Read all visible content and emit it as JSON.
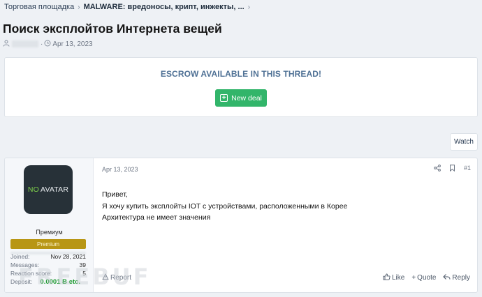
{
  "breadcrumb": {
    "items": [
      "Торговая площадка",
      "MALWARE: вредоносы, крипт, инжекты, ..."
    ],
    "separator": "›"
  },
  "thread": {
    "title": "Поиск эксплойтов Интернета вещей",
    "meta_separator": "·",
    "date": "Apr 13, 2023"
  },
  "escrow": {
    "title": "ESCROW AVAILABLE IN THIS THREAD!",
    "button_label": "New deal"
  },
  "watch_label": "Watch",
  "post": {
    "avatar": {
      "no": "NO",
      "avatar": "AVATAR"
    },
    "user_title": "Премиум",
    "user_banner": "Premium",
    "stats": [
      {
        "label": "Joined:",
        "value": "Nov 28, 2021"
      },
      {
        "label": "Messages:",
        "value": "39"
      },
      {
        "label": "Reaction score:",
        "value": "5"
      },
      {
        "label": "Deposit:",
        "value": "0.0001 Ƀ etc."
      }
    ],
    "date": "Apr 13, 2023",
    "number": "#1",
    "message_lines": [
      "Привет,",
      "Я хочу купить эксплойты IOT с устройствами, расположенными в Корее",
      "Архитектура не имеет значения"
    ],
    "report_label": "Report",
    "like_label": "Like",
    "quote_label": "Quote",
    "reply_label": "Reply"
  },
  "watermark": "FREEBUF",
  "colors": {
    "accent_blue": "#4f7195",
    "deal_green": "#32b56a",
    "banner_gold": "#b89615",
    "deposit_green": "#1a9a2e"
  }
}
